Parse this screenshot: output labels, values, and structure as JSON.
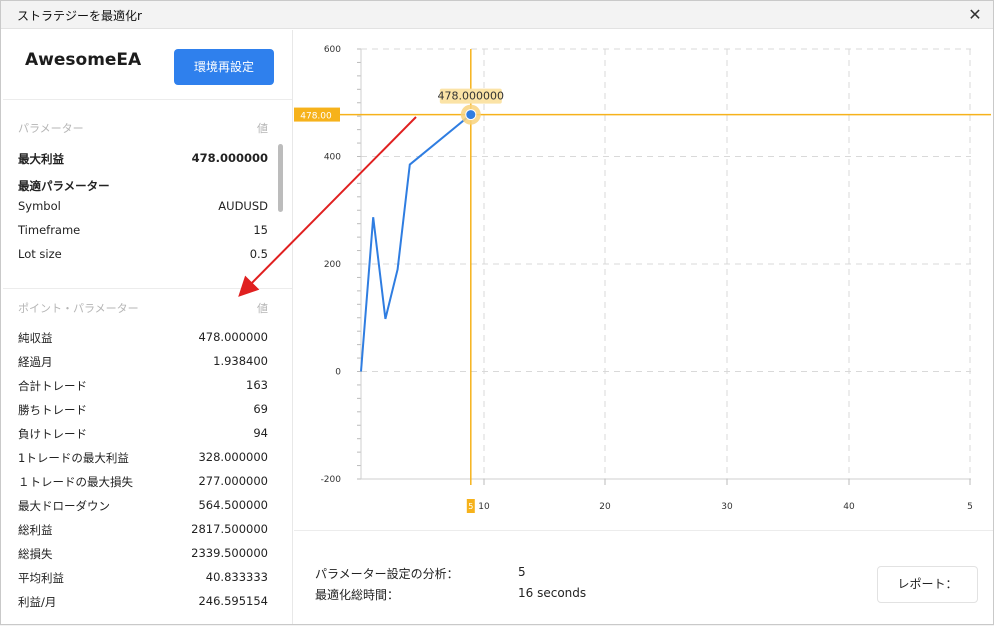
{
  "window": {
    "title": "ストラテジーを最適化r",
    "close_glyph": "✕"
  },
  "left": {
    "ea_name": "AwesomeEA",
    "reset_button": "環境再設定",
    "params_header": {
      "label": "パラメーター",
      "value_label": "値"
    },
    "max_profit": {
      "label": "最大利益",
      "value": "478.000000"
    },
    "best_params_label": "最適パラメーター",
    "params": [
      {
        "label": "Symbol",
        "value": "AUDUSD"
      },
      {
        "label": "Timeframe",
        "value": "15"
      },
      {
        "label": "Lot size",
        "value": "0.5"
      }
    ],
    "point_header": {
      "label": "ポイント・パラメーター",
      "value_label": "値"
    },
    "stats": [
      {
        "label": "純収益",
        "value": "478.000000"
      },
      {
        "label": "経過月",
        "value": "1.938400"
      },
      {
        "label": "合計トレード",
        "value": "163"
      },
      {
        "label": "勝ちトレード",
        "value": "69"
      },
      {
        "label": "負けトレード",
        "value": "94"
      },
      {
        "label": "1トレードの最大利益",
        "value": "328.000000"
      },
      {
        "label": "１トレードの最大損失",
        "value": "277.000000"
      },
      {
        "label": "最大ドローダウン",
        "value": "564.500000"
      },
      {
        "label": "総利益",
        "value": "2817.500000"
      },
      {
        "label": "総損失",
        "value": "2339.500000"
      },
      {
        "label": "平均利益",
        "value": "40.833333"
      },
      {
        "label": "利益/月",
        "value": "246.595154"
      }
    ]
  },
  "chart_data": {
    "type": "line",
    "x": [
      1,
      2,
      3,
      4,
      5,
      6
    ],
    "values": [
      0,
      287,
      98,
      190,
      385,
      478
    ],
    "y_ticks": [
      "600",
      "400",
      "200",
      "0",
      "-200"
    ],
    "x_ticks": [
      "10",
      "20",
      "30",
      "40",
      "5"
    ],
    "ylim": [
      -200,
      600
    ],
    "crosshair": {
      "x_label": "5",
      "y_label": "478.00",
      "point_label": "478.000000"
    },
    "colors": {
      "line": "#2f7de1",
      "crosshair": "#f6b21b",
      "grid": "#d9d9d9",
      "arrow": "#e02020"
    },
    "grid": true
  },
  "footer": {
    "analyzed_label": "パラメーター設定の分析：",
    "analyzed_value": "5",
    "time_label": "最適化総時間：",
    "time_value": "16 seconds",
    "report_button": "レポート："
  }
}
